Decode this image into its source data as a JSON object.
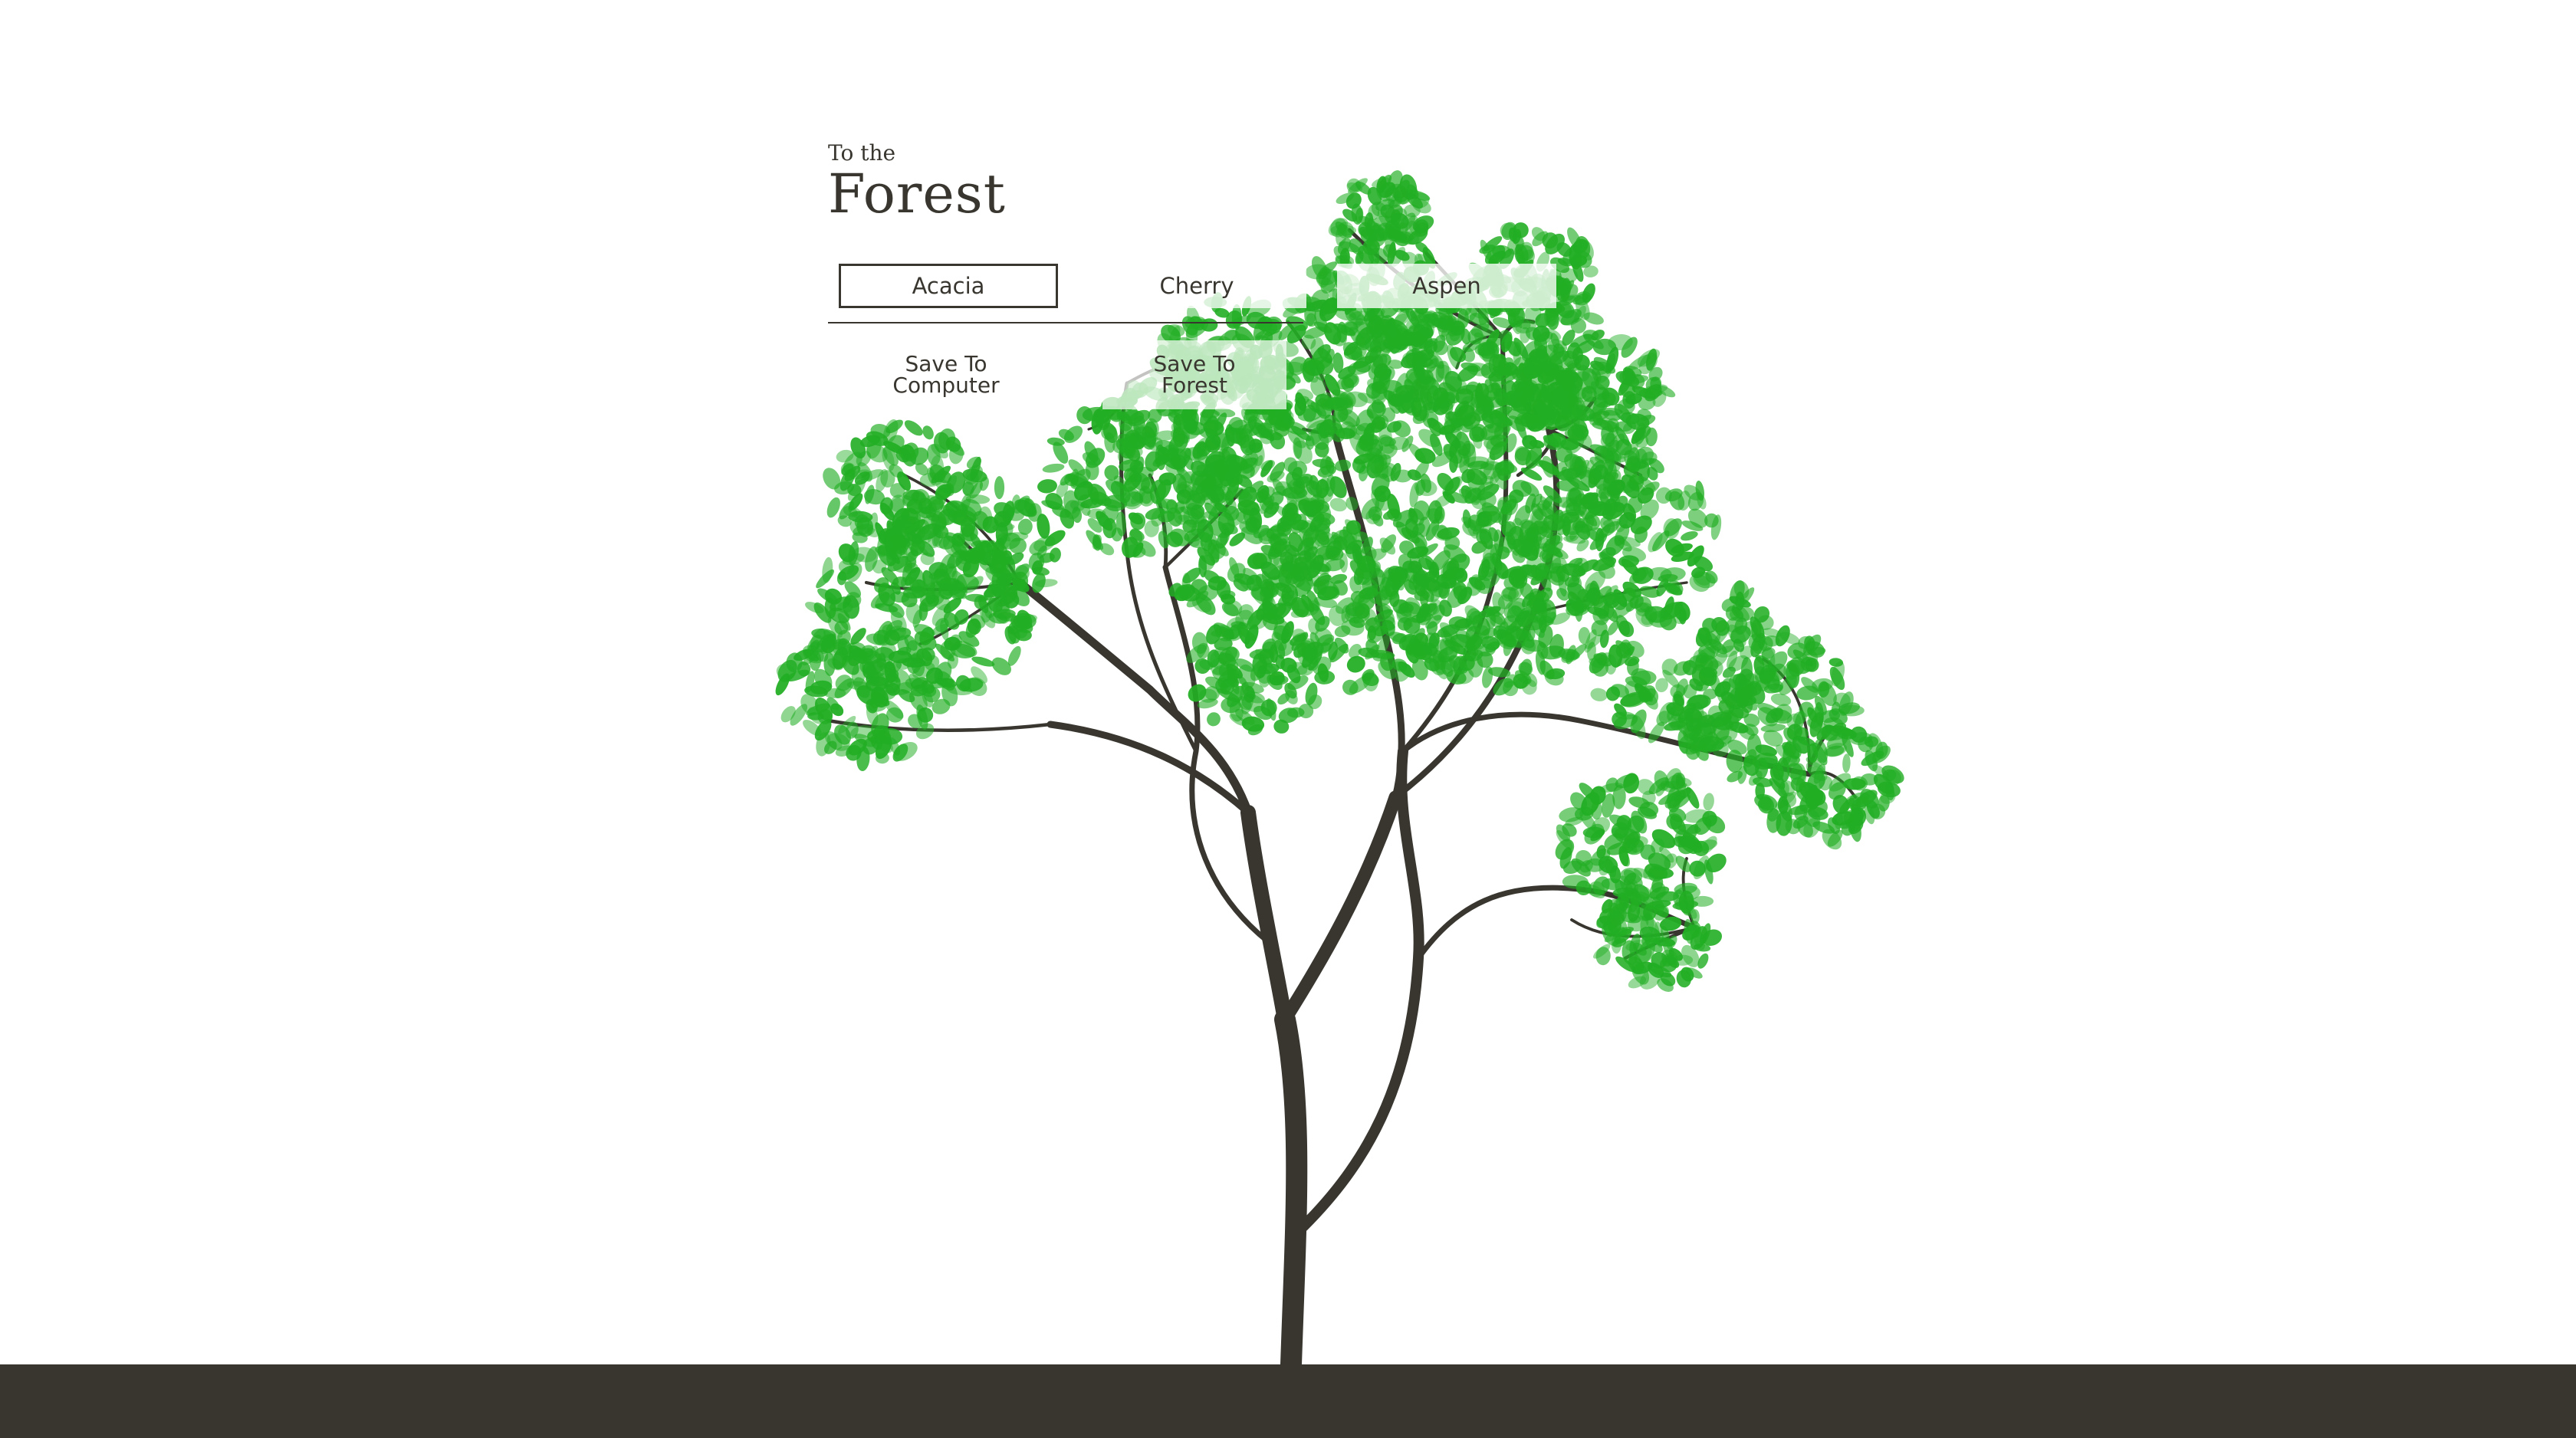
{
  "header": {
    "title_small": "To the",
    "title_big": "Forest"
  },
  "tree_types": [
    {
      "label": "Acacia",
      "selected": true
    },
    {
      "label": "Cherry",
      "selected": false
    },
    {
      "label": "Aspen",
      "selected": false
    }
  ],
  "actions": {
    "save_computer_line1": "Save To",
    "save_computer_line2": "Computer",
    "save_forest_line1": "Save To",
    "save_forest_line2": "Forest"
  },
  "colors": {
    "leaf": "#22ae24",
    "trunk": "#38362f",
    "ground": "#38362f",
    "background": "#ffffff"
  }
}
